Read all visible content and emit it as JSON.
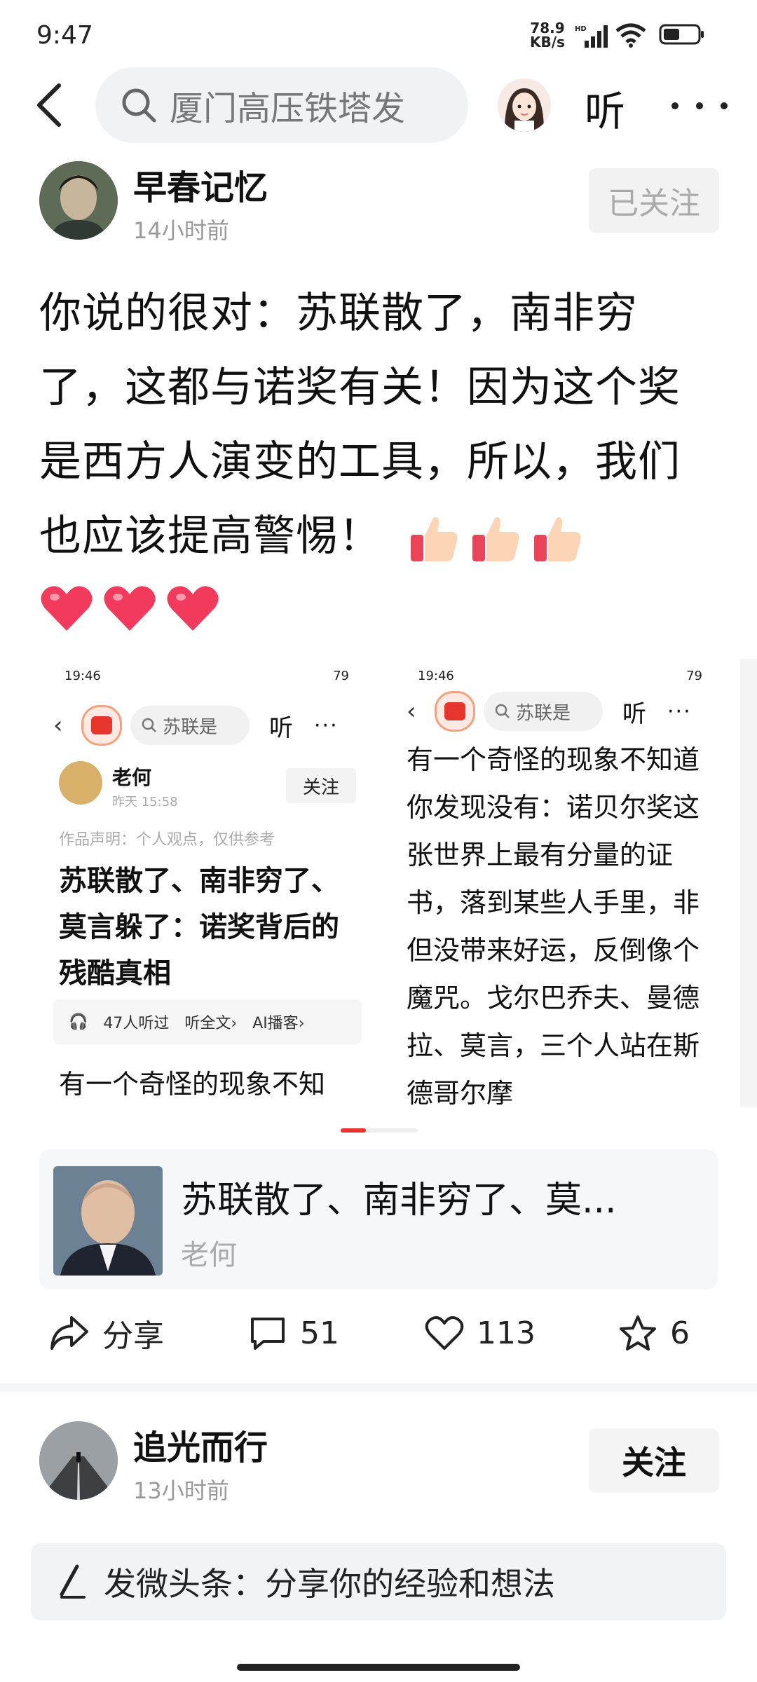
{
  "status_bar": {
    "time": "9:47",
    "speed_value": "78.9",
    "speed_unit": "KB/s",
    "network": "HD"
  },
  "top_bar": {
    "search_text": "厦门高压铁塔发",
    "listen_label": "听"
  },
  "post": {
    "author": "早春记忆",
    "time": "14小时前",
    "follow_state": "已关注",
    "body": "你说的很对：苏联散了，南非穷了，这都与诺奖有关！因为这个奖是西方人演变的工具，所以，我们也应该提高警惕！",
    "emoji_icons": [
      "thumbs-up-icon",
      "thumbs-up-icon",
      "thumbs-up-icon"
    ],
    "heart_icons": [
      "heart-icon",
      "heart-icon",
      "heart-icon"
    ]
  },
  "screenshots": [
    {
      "status_time": "19:46",
      "status_right": "79",
      "search": "苏联是",
      "listen": "听",
      "author": "老何",
      "time": "昨天 15:58",
      "follow": "关注",
      "disclaimer": "作品声明：个人观点，仅供参考",
      "title": "苏联散了、南非穷了、莫言躲了：诺奖背后的残酷真相",
      "listeners": "47人听过",
      "listen_all": "听全文›",
      "ai_podcast": "AI播客›",
      "snippet": "有一个奇怪的现象不知"
    },
    {
      "status_time": "19:46",
      "status_right": "79",
      "search": "苏联是",
      "listen": "听",
      "text": "有一个奇怪的现象不知道你发现没有：诺贝尔奖这张世界上最有分量的证书，落到某些人手里，非但没带来好运，反倒像个魔咒。戈尔巴乔夫、曼德拉、莫言，三个人站在斯德哥尔摩"
    }
  ],
  "article_card": {
    "title": "苏联散了、南非穷了、莫...",
    "author": "老何"
  },
  "actions": {
    "share_label": "分享",
    "comments": "51",
    "likes": "113",
    "favorites": "6"
  },
  "post2": {
    "author": "追光而行",
    "time": "13小时前",
    "follow_label": "关注"
  },
  "composer": {
    "placeholder": "发微头条：分享你的经验和想法"
  },
  "colors": {
    "accent": "#e8352b",
    "follow_bg": "#f2f2f2",
    "card_bg": "#f6f7f9"
  }
}
